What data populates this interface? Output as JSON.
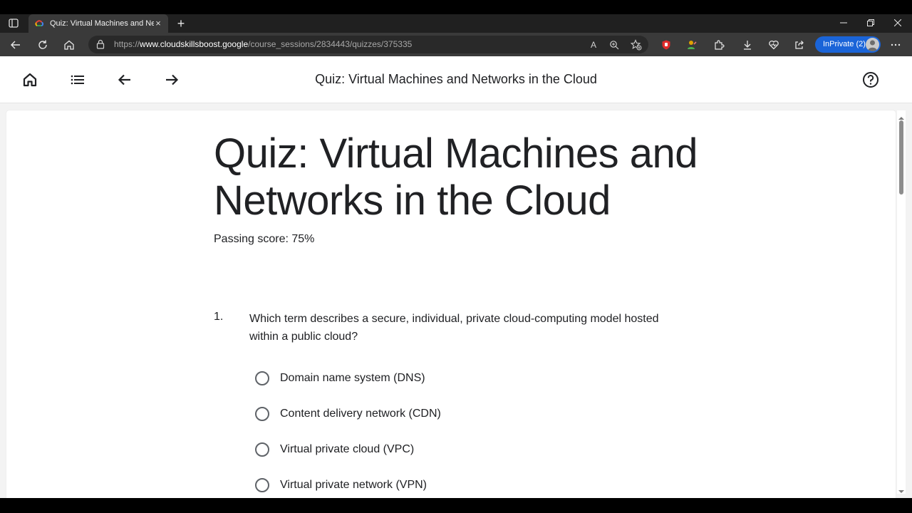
{
  "browser": {
    "tab_title": "Quiz: Virtual Machines and Netw",
    "tab_close": "×",
    "new_tab": "+",
    "url_scheme": "https://",
    "url_host": "www.cloudskillsboost.google",
    "url_path": "/course_sessions/2834443/quizzes/375335",
    "inprivate_label": "InPrivate (2)",
    "read_aloud_label": "A",
    "icons": [
      "tab-actions-icon",
      "back-icon",
      "refresh-icon",
      "home-icon",
      "lock-icon",
      "read-aloud-icon",
      "zoom-icon",
      "favorites-add-icon",
      "extension-shield-icon",
      "extension-person-icon",
      "extensions-icon",
      "downloads-icon",
      "browser-essentials-icon",
      "share-icon",
      "more-icon"
    ],
    "accent_color": "#1a64d8"
  },
  "header": {
    "title": "Quiz: Virtual Machines and Networks in the Cloud",
    "icons": [
      "home-icon",
      "list-icon",
      "arrow-back-icon",
      "arrow-forward-icon",
      "help-icon"
    ]
  },
  "quiz": {
    "title": "Quiz: Virtual Machines and Networks in the Cloud",
    "passing_score": "Passing score: 75%",
    "questions": [
      {
        "number": "1.",
        "text": "Which term describes a secure, individual, private cloud-computing model hosted within a public cloud?",
        "options": [
          "Domain name system (DNS)",
          "Content delivery network (CDN)",
          "Virtual private cloud (VPC)",
          "Virtual private network (VPN)"
        ]
      }
    ]
  }
}
